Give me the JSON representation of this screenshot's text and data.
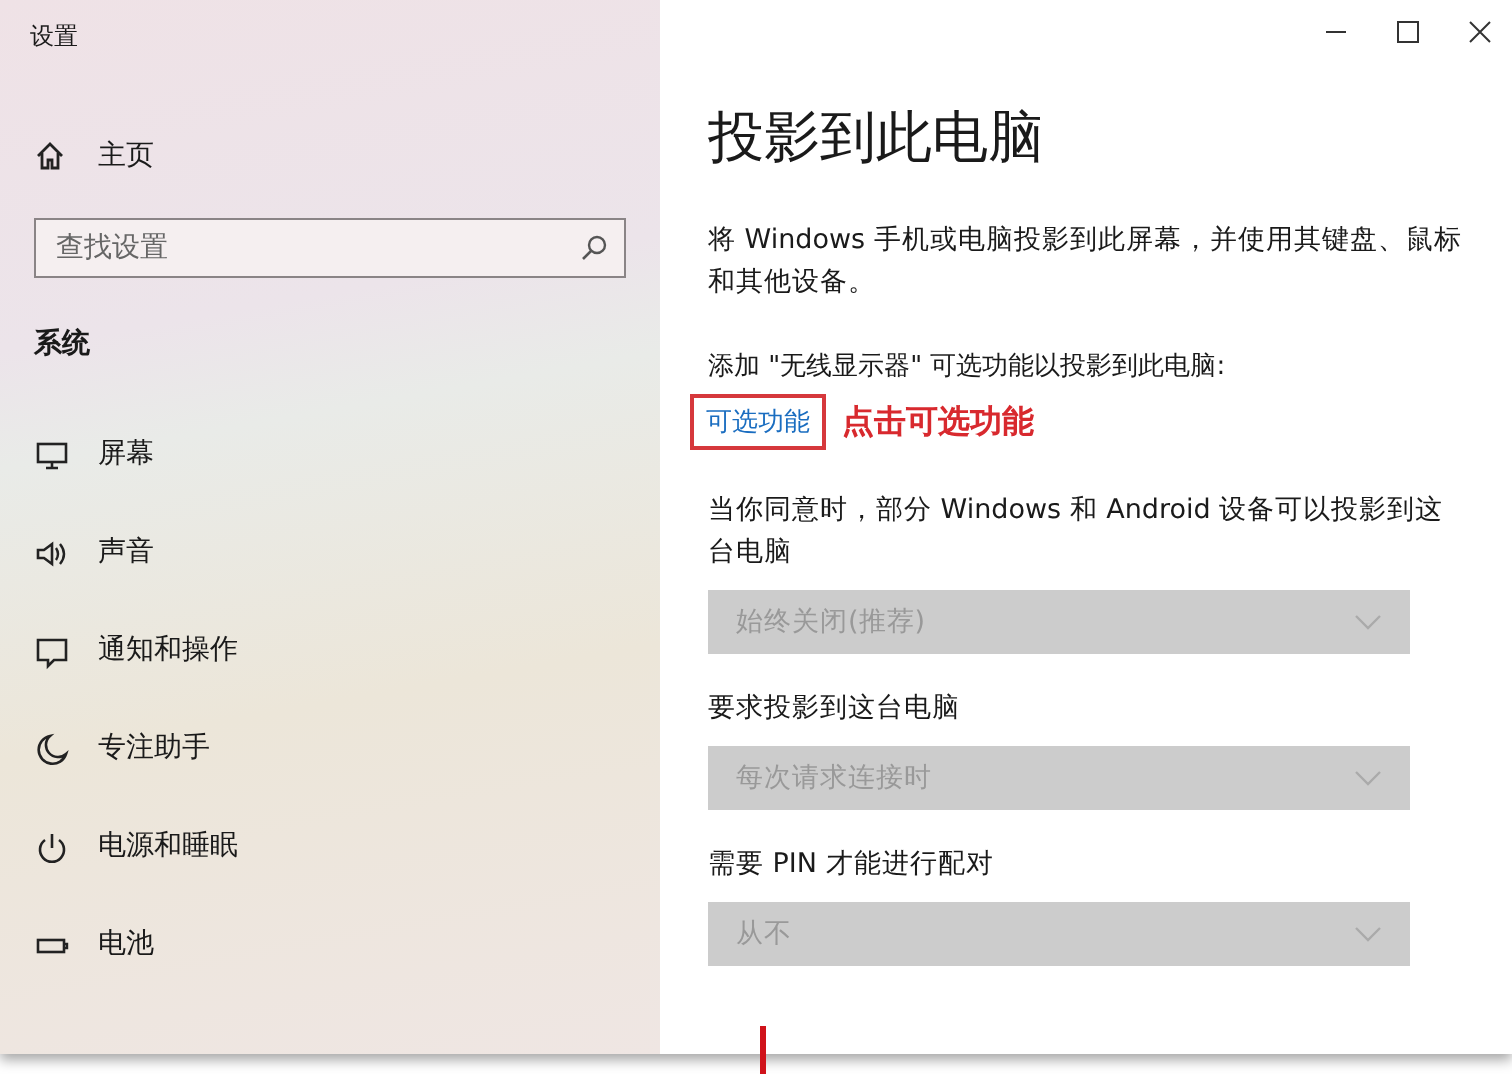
{
  "window": {
    "title": "设置"
  },
  "sidebar": {
    "home": "主页",
    "search": {
      "placeholder": "查找设置"
    },
    "section": "系统",
    "items": [
      {
        "label": "屏幕"
      },
      {
        "label": "声音"
      },
      {
        "label": "通知和操作"
      },
      {
        "label": "专注助手"
      },
      {
        "label": "电源和睡眠"
      },
      {
        "label": "电池"
      }
    ]
  },
  "page": {
    "title": "投影到此电脑",
    "description": "将 Windows 手机或电脑投影到此屏幕，并使用其键盘、鼠标和其他设备。",
    "add_label": "添加 \"无线显示器\" 可选功能以投影到此电脑:",
    "link": "可选功能",
    "annotation": "点击可选功能",
    "settings": [
      {
        "label": "当你同意时，部分 Windows 和 Android 设备可以投影到这台电脑",
        "value": "始终关闭(推荐)",
        "disabled": true
      },
      {
        "label": "要求投影到这台电脑",
        "value": "每次请求连接时",
        "disabled": true
      },
      {
        "label": "需要 PIN 才能进行配对",
        "value": "从不",
        "disabled": true
      }
    ]
  }
}
